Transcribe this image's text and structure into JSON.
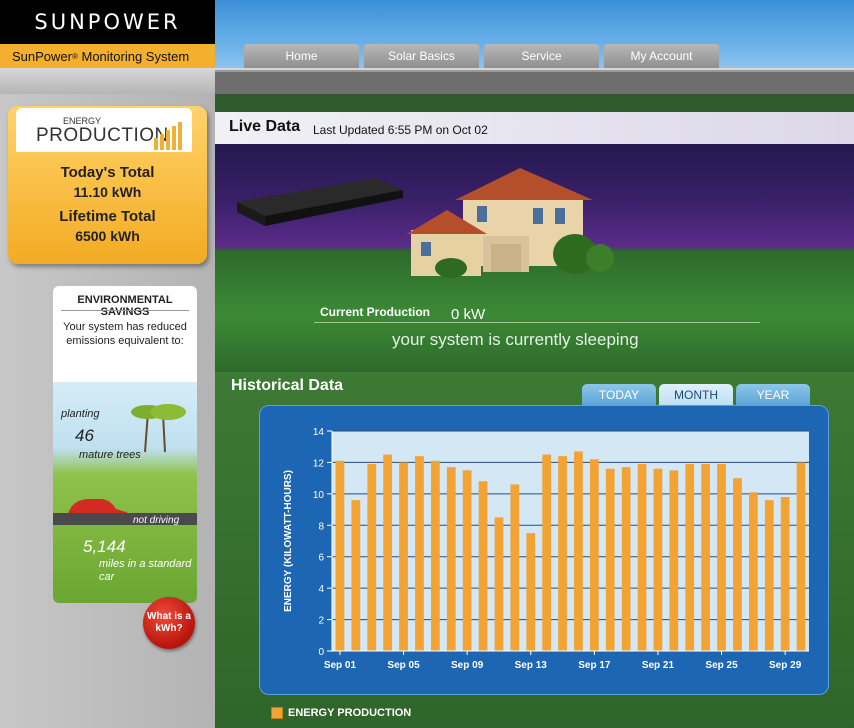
{
  "header": {
    "logo": "SUNPOWER",
    "subtitle": "SunPower",
    "subtitle_mark": "®",
    "subtitle_rest": " Monitoring System",
    "nav": [
      "Home",
      "Solar Basics",
      "Service",
      "My Account"
    ]
  },
  "production": {
    "energy_word": "ENERGY",
    "title": "PRODUCTION",
    "today_label": "Today's Total",
    "today_value": "11.10 kWh",
    "lifetime_label": "Lifetime Total",
    "lifetime_value": "6500 kWh"
  },
  "environment": {
    "title": "ENVIRONMENTAL SAVINGS",
    "description": "Your system has reduced emissions equivalent to:",
    "planting_label": "planting",
    "trees_count": "46",
    "trees_label": "mature trees",
    "not_driving_label": "not driving",
    "miles_count": "5,144",
    "miles_label": "miles in a standard car",
    "kwh_button": "What is a kWh?"
  },
  "live": {
    "title": "Live Data",
    "updated": "Last Updated 6:55 PM on Oct 02",
    "current_label": "Current Production",
    "current_value": "0 kW",
    "status": "your system is currently sleeping"
  },
  "historical": {
    "title": "Historical Data",
    "tabs": [
      "TODAY",
      "MONTH",
      "YEAR"
    ],
    "active_tab": "MONTH",
    "legend": "ENERGY PRODUCTION"
  },
  "colors": {
    "bar": "#f3a234",
    "plot_bg": "#d4e7f4",
    "panel": "#1d66b3",
    "accent": "#f3b02e"
  },
  "chart_data": {
    "type": "bar",
    "ylabel": "ENERGY (KILOWATT-HOURS)",
    "ylim": [
      0,
      14
    ],
    "yticks": [
      0,
      2,
      4,
      6,
      8,
      10,
      12,
      14
    ],
    "xtick_labels": [
      "Sep 01",
      "Sep 05",
      "Sep 09",
      "Sep 13",
      "Sep 17",
      "Sep 21",
      "Sep 25",
      "Sep 29"
    ],
    "xtick_days": [
      1,
      5,
      9,
      13,
      17,
      21,
      25,
      29
    ],
    "days": [
      1,
      2,
      3,
      4,
      5,
      6,
      7,
      8,
      9,
      10,
      11,
      12,
      13,
      14,
      15,
      16,
      17,
      18,
      19,
      20,
      21,
      22,
      23,
      24,
      25,
      26,
      27,
      28,
      29,
      30
    ],
    "series": [
      {
        "name": "ENERGY PRODUCTION",
        "values": [
          12.1,
          9.6,
          11.9,
          12.5,
          12.0,
          12.4,
          12.1,
          11.7,
          11.5,
          10.8,
          8.5,
          10.6,
          7.5,
          12.5,
          12.4,
          12.7,
          12.2,
          11.6,
          11.7,
          11.9,
          11.6,
          11.5,
          11.9,
          11.9,
          11.9,
          11.0,
          10.1,
          9.6,
          9.8,
          12.0
        ]
      }
    ]
  }
}
